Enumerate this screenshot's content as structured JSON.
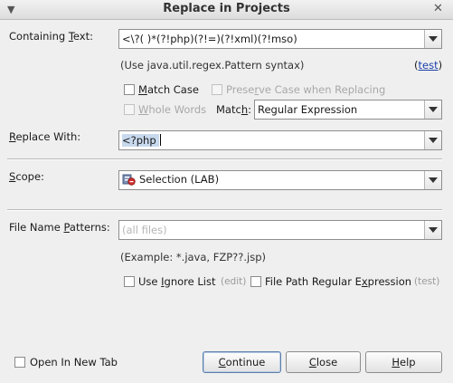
{
  "window": {
    "title": "Replace in Projects"
  },
  "containing_text": {
    "label_pre": "Containing ",
    "label_ul": "T",
    "label_post": "ext:",
    "value": "<\\?( )*(?!php)(?!=)(?!xml)(?!mso)",
    "hint": "(Use java.util.regex.Pattern syntax)",
    "test_open": "(",
    "test_link": "test",
    "test_close": ")"
  },
  "options": {
    "match_case": {
      "pre": "",
      "ul": "M",
      "post": "atch Case",
      "checked": false
    },
    "preserve_case": {
      "pre": "Prese",
      "ul": "r",
      "post": "ve Case when Replacing",
      "checked": false,
      "disabled": true
    },
    "whole_words": {
      "pre": "",
      "ul": "W",
      "post": "hole Words",
      "checked": false,
      "disabled": true
    },
    "match_label_pre": "Matc",
    "match_label_ul": "h",
    "match_label_post": ":",
    "match_value": "Regular Expression"
  },
  "replace_with": {
    "label_pre": "",
    "label_ul": "R",
    "label_post": "eplace With:",
    "value": "<?php "
  },
  "scope": {
    "label_pre": "",
    "label_ul": "S",
    "label_post": "cope:",
    "value": "Selection (LAB)",
    "icon": "project-icon"
  },
  "file_patterns": {
    "label_pre": "File Name ",
    "label_ul": "P",
    "label_post": "atterns:",
    "placeholder": "(all files)",
    "example": "(Example: *.java, FZP??.jsp)"
  },
  "ignore": {
    "use_ignore_pre": "Use ",
    "use_ignore_ul": "I",
    "use_ignore_post": "gnore List",
    "edit": "(edit)",
    "file_path_pre": "File Path Regular E",
    "file_path_ul": "x",
    "file_path_post": "pression",
    "test": "(test)"
  },
  "footer": {
    "open_new_tab": "Open In New Tab",
    "continue_pre": "",
    "continue_ul": "C",
    "continue_post": "ontinue",
    "close_pre": "",
    "close_ul": "C",
    "close_post": "lose",
    "help_pre": "",
    "help_ul": "H",
    "help_post": "elp"
  },
  "colors": {
    "accent": "#5d7ea9",
    "selection": "#c8d9ee",
    "link": "#1a3fa8"
  }
}
